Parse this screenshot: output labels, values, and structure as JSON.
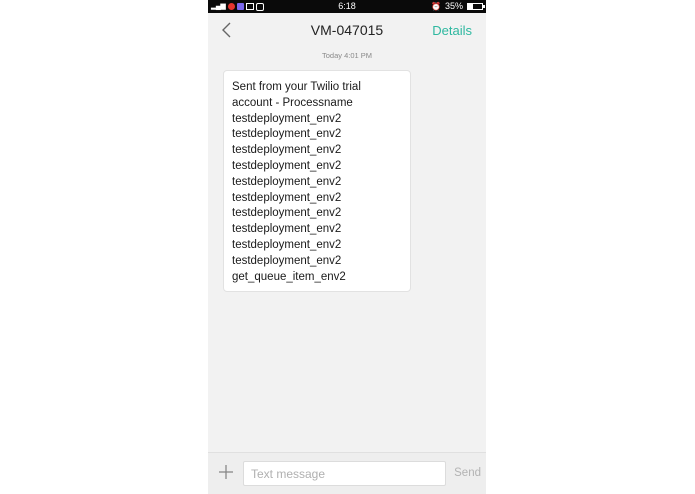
{
  "status_bar": {
    "signal": "3G",
    "time": "6:18",
    "battery_percent": "35%",
    "battery_level": 0.35
  },
  "header": {
    "title": "VM-047015",
    "details_label": "Details"
  },
  "conversation": {
    "timestamp": "Today  4:01 PM",
    "message_lines": [
      "Sent from your Twilio trial",
      "account - Processname",
      "testdeployment_env2",
      "testdeployment_env2",
      "testdeployment_env2",
      "testdeployment_env2",
      "testdeployment_env2",
      "testdeployment_env2",
      "testdeployment_env2",
      "testdeployment_env2",
      "testdeployment_env2",
      "testdeployment_env2",
      "get_queue_item_env2"
    ]
  },
  "composer": {
    "placeholder": "Text message",
    "send_label": "Send"
  },
  "colors": {
    "accent": "#2eb8a0",
    "background": "#f2f2f2",
    "status_bar": "#0a0a0a"
  },
  "icons": {
    "back": "chevron-left-icon",
    "attach": "plus-icon"
  }
}
